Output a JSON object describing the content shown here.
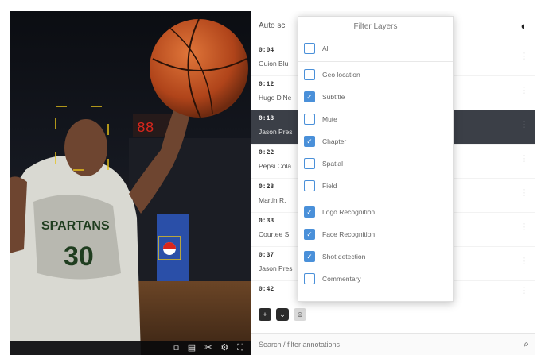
{
  "video": {
    "controls": [
      {
        "icon": "screen-share-icon",
        "glyph": "⧉"
      },
      {
        "icon": "subtitles-icon",
        "glyph": "▤"
      },
      {
        "icon": "scissors-icon",
        "glyph": "✂"
      },
      {
        "icon": "settings-icon",
        "glyph": "⚙"
      },
      {
        "icon": "fullscreen-icon",
        "glyph": "⛶"
      }
    ],
    "jersey_text": "SPARTANS",
    "jersey_number": "30"
  },
  "panel": {
    "title": "Auto sc",
    "toggle_glyph": "◖",
    "rows": [
      {
        "time": "0:04",
        "name": "Guion Blu",
        "selected": false
      },
      {
        "time": "0:12",
        "name": "Hugo D'Ne",
        "selected": false
      },
      {
        "time": "0:18",
        "name": "Jason Pres",
        "selected": true
      },
      {
        "time": "0:22",
        "name": "Pepsi Cola",
        "selected": false
      },
      {
        "time": "0:28",
        "name": "Martin R.",
        "selected": false
      },
      {
        "time": "0:33",
        "name": "Courtee S",
        "selected": false
      },
      {
        "time": "0:37",
        "name": "Jason Pres",
        "selected": false
      },
      {
        "time": "0:42",
        "name": "",
        "selected": false
      }
    ],
    "kebab_glyph": "⋮",
    "actions": [
      {
        "icon": "add-icon",
        "glyph": "+"
      },
      {
        "icon": "chevron-down-icon",
        "glyph": "⌄"
      },
      {
        "icon": "layers-icon",
        "glyph": "⊜"
      }
    ],
    "search": {
      "placeholder": "Search / filter annotations",
      "icon_glyph": "⌕"
    }
  },
  "filter": {
    "title": "Filter Layers",
    "check_glyph": "✓",
    "groups": [
      [
        {
          "label": "All",
          "checked": false
        }
      ],
      [
        {
          "label": "Geo location",
          "checked": false
        },
        {
          "label": "Subtitle",
          "checked": true
        },
        {
          "label": "Mute",
          "checked": false
        },
        {
          "label": "Chapter",
          "checked": true
        },
        {
          "label": "Spatial",
          "checked": false
        },
        {
          "label": "Field",
          "checked": false
        }
      ],
      [
        {
          "label": "Logo Recognition",
          "checked": true
        },
        {
          "label": "Face Recognition",
          "checked": true
        },
        {
          "label": "Shot detection",
          "checked": true
        },
        {
          "label": "Commentary",
          "checked": false
        }
      ]
    ]
  },
  "colors": {
    "accent": "#4a90d9",
    "face_box": "#e6c21a",
    "selected_row": "#3b3f47"
  }
}
